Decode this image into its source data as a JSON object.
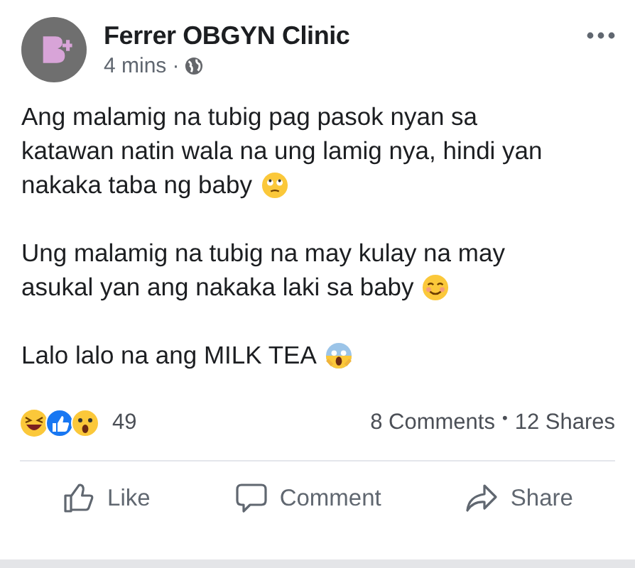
{
  "post": {
    "author": "Ferrer OBGYN Clinic",
    "time": "4 mins",
    "separator": "·",
    "paragraphs": [
      {
        "lines": [
          "Ang malamig na tubig pag pasok nyan sa",
          "katawan natin wala na ung lamig nya, hindi yan",
          "nakaka taba ng baby"
        ]
      },
      {
        "lines": [
          "Ung malamig na tubig na may kulay na may",
          "asukal yan ang nakaka laki sa baby"
        ]
      },
      {
        "lines": [
          "Lalo lalo na ang MILK TEA"
        ]
      }
    ],
    "reaction_count": "49",
    "comments": "8 Comments",
    "stats_separator": "•",
    "shares": "12 Shares",
    "actions": [
      "Like",
      "Comment",
      "Share"
    ]
  }
}
